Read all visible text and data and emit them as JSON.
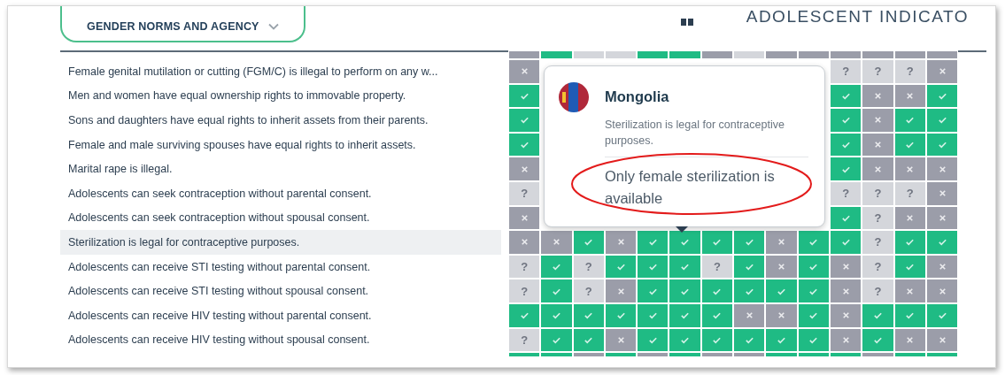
{
  "header": {
    "dropdown": {
      "label": "GENDER NORMS AND AGENCY",
      "expanded": false
    },
    "title": "ADOLESCENT INDICATO"
  },
  "top_partial_row": [
    {
      "kind": "no"
    },
    {
      "kind": "yes"
    },
    {
      "kind": "unknown"
    },
    {
      "kind": "unknown"
    },
    {
      "kind": "yes"
    },
    {
      "kind": "yes"
    },
    {
      "kind": "no"
    },
    {
      "kind": "unknown"
    },
    {
      "kind": "no"
    },
    {
      "kind": "no"
    },
    {
      "kind": "no"
    },
    {
      "kind": "no"
    },
    {
      "kind": "no"
    },
    {
      "kind": "no"
    }
  ],
  "rows": [
    {
      "label": "Female genital mutilation or cutting (FGM/C) is illegal to perform on any w...",
      "selected": false,
      "cells": [
        {
          "kind": "no"
        },
        null,
        null,
        null,
        null,
        null,
        null,
        null,
        null,
        null,
        {
          "kind": "unknown",
          "label": "?"
        },
        {
          "kind": "unknown",
          "label": "?"
        },
        {
          "kind": "unknown",
          "label": "?"
        },
        {
          "kind": "no"
        }
      ]
    },
    {
      "label": "Men and women have equal ownership rights to immovable property.",
      "selected": false,
      "cells": [
        {
          "kind": "yes"
        },
        null,
        null,
        null,
        null,
        null,
        null,
        null,
        null,
        null,
        {
          "kind": "yes"
        },
        {
          "kind": "no"
        },
        {
          "kind": "no"
        },
        {
          "kind": "yes"
        }
      ]
    },
    {
      "label": "Sons and daughters have equal rights to inherit assets from their parents.",
      "selected": false,
      "cells": [
        {
          "kind": "yes"
        },
        null,
        null,
        null,
        null,
        null,
        null,
        null,
        null,
        null,
        {
          "kind": "yes"
        },
        {
          "kind": "no"
        },
        {
          "kind": "yes"
        },
        {
          "kind": "yes"
        }
      ]
    },
    {
      "label": "Female and male surviving spouses have equal rights to inherit assets.",
      "selected": false,
      "cells": [
        {
          "kind": "yes"
        },
        null,
        null,
        null,
        null,
        null,
        null,
        null,
        null,
        null,
        {
          "kind": "yes"
        },
        {
          "kind": "no"
        },
        {
          "kind": "yes"
        },
        {
          "kind": "yes"
        }
      ]
    },
    {
      "label": "Marital rape is illegal.",
      "selected": false,
      "cells": [
        {
          "kind": "no"
        },
        null,
        null,
        null,
        null,
        null,
        null,
        null,
        null,
        null,
        {
          "kind": "yes"
        },
        {
          "kind": "no"
        },
        {
          "kind": "no"
        },
        {
          "kind": "no"
        }
      ]
    },
    {
      "label": "Adolescents can seek contraception without parental consent.",
      "selected": false,
      "cells": [
        {
          "kind": "unknown",
          "label": "?"
        },
        null,
        null,
        null,
        null,
        null,
        null,
        null,
        null,
        null,
        {
          "kind": "unknown",
          "label": "?"
        },
        {
          "kind": "unknown",
          "label": "?"
        },
        {
          "kind": "unknown",
          "label": "?"
        },
        {
          "kind": "no"
        }
      ]
    },
    {
      "label": "Adolescents can seek contraception without spousal consent.",
      "selected": false,
      "cells": [
        {
          "kind": "no"
        },
        null,
        null,
        null,
        null,
        null,
        null,
        null,
        null,
        null,
        {
          "kind": "yes"
        },
        {
          "kind": "unknown",
          "label": "?"
        },
        {
          "kind": "no"
        },
        {
          "kind": "no"
        }
      ]
    },
    {
      "label": "Sterilization is legal for contraceptive purposes.",
      "selected": true,
      "cells": [
        {
          "kind": "no"
        },
        {
          "kind": "no"
        },
        {
          "kind": "yes"
        },
        {
          "kind": "no"
        },
        {
          "kind": "yes"
        },
        {
          "kind": "yes"
        },
        {
          "kind": "yes"
        },
        {
          "kind": "yes"
        },
        {
          "kind": "no"
        },
        {
          "kind": "yes"
        },
        {
          "kind": "yes"
        },
        {
          "kind": "unknown",
          "label": "?"
        },
        {
          "kind": "yes"
        },
        {
          "kind": "yes"
        }
      ]
    },
    {
      "label": "Adolescents can receive STI testing without parental consent.",
      "selected": false,
      "cells": [
        {
          "kind": "unknown",
          "label": "?"
        },
        {
          "kind": "yes"
        },
        {
          "kind": "unknown",
          "label": "?"
        },
        {
          "kind": "yes"
        },
        {
          "kind": "yes"
        },
        {
          "kind": "yes"
        },
        {
          "kind": "unknown",
          "label": "?"
        },
        {
          "kind": "yes"
        },
        {
          "kind": "no"
        },
        {
          "kind": "yes"
        },
        {
          "kind": "no"
        },
        {
          "kind": "unknown",
          "label": "?"
        },
        {
          "kind": "yes"
        },
        {
          "kind": "no"
        }
      ]
    },
    {
      "label": "Adolescents can receive STI testing without spousal consent.",
      "selected": false,
      "cells": [
        {
          "kind": "unknown",
          "label": "?"
        },
        {
          "kind": "yes"
        },
        {
          "kind": "unknown",
          "label": "?"
        },
        {
          "kind": "no"
        },
        {
          "kind": "yes"
        },
        {
          "kind": "yes"
        },
        {
          "kind": "yes"
        },
        {
          "kind": "yes"
        },
        {
          "kind": "yes"
        },
        {
          "kind": "yes"
        },
        {
          "kind": "no"
        },
        {
          "kind": "unknown",
          "label": "?"
        },
        {
          "kind": "no"
        },
        {
          "kind": "no"
        }
      ]
    },
    {
      "label": "Adolescents can receive HIV testing without parental consent.",
      "selected": false,
      "cells": [
        {
          "kind": "yes"
        },
        {
          "kind": "yes"
        },
        {
          "kind": "yes"
        },
        {
          "kind": "yes"
        },
        {
          "kind": "yes"
        },
        {
          "kind": "yes"
        },
        {
          "kind": "yes"
        },
        {
          "kind": "no"
        },
        {
          "kind": "no"
        },
        {
          "kind": "yes"
        },
        {
          "kind": "no"
        },
        {
          "kind": "yes"
        },
        {
          "kind": "yes"
        },
        {
          "kind": "yes"
        }
      ]
    },
    {
      "label": "Adolescents can receive HIV testing without spousal consent.",
      "selected": false,
      "cells": [
        {
          "kind": "unknown",
          "label": "?"
        },
        {
          "kind": "yes"
        },
        {
          "kind": "yes"
        },
        {
          "kind": "no"
        },
        {
          "kind": "yes"
        },
        {
          "kind": "yes"
        },
        {
          "kind": "yes"
        },
        {
          "kind": "yes"
        },
        {
          "kind": "yes"
        },
        {
          "kind": "yes"
        },
        {
          "kind": "no"
        },
        {
          "kind": "yes"
        },
        {
          "kind": "no"
        },
        {
          "kind": "no"
        }
      ]
    }
  ],
  "bottom_partial_row": [
    {
      "kind": "yes"
    },
    {
      "kind": "yes"
    },
    {
      "kind": "no"
    },
    {
      "kind": "yes"
    },
    {
      "kind": "no"
    },
    {
      "kind": "yes"
    },
    {
      "kind": "no"
    },
    {
      "kind": "no"
    },
    {
      "kind": "yes"
    },
    {
      "kind": "yes"
    },
    {
      "kind": "yes"
    },
    {
      "kind": "no"
    },
    {
      "kind": "yes"
    },
    {
      "kind": "yes"
    }
  ],
  "tooltip": {
    "country": "Mongolia",
    "indicator": "Sterilization is legal for contraceptive purposes.",
    "note": "Only female sterilization is available",
    "note_circled": true
  }
}
